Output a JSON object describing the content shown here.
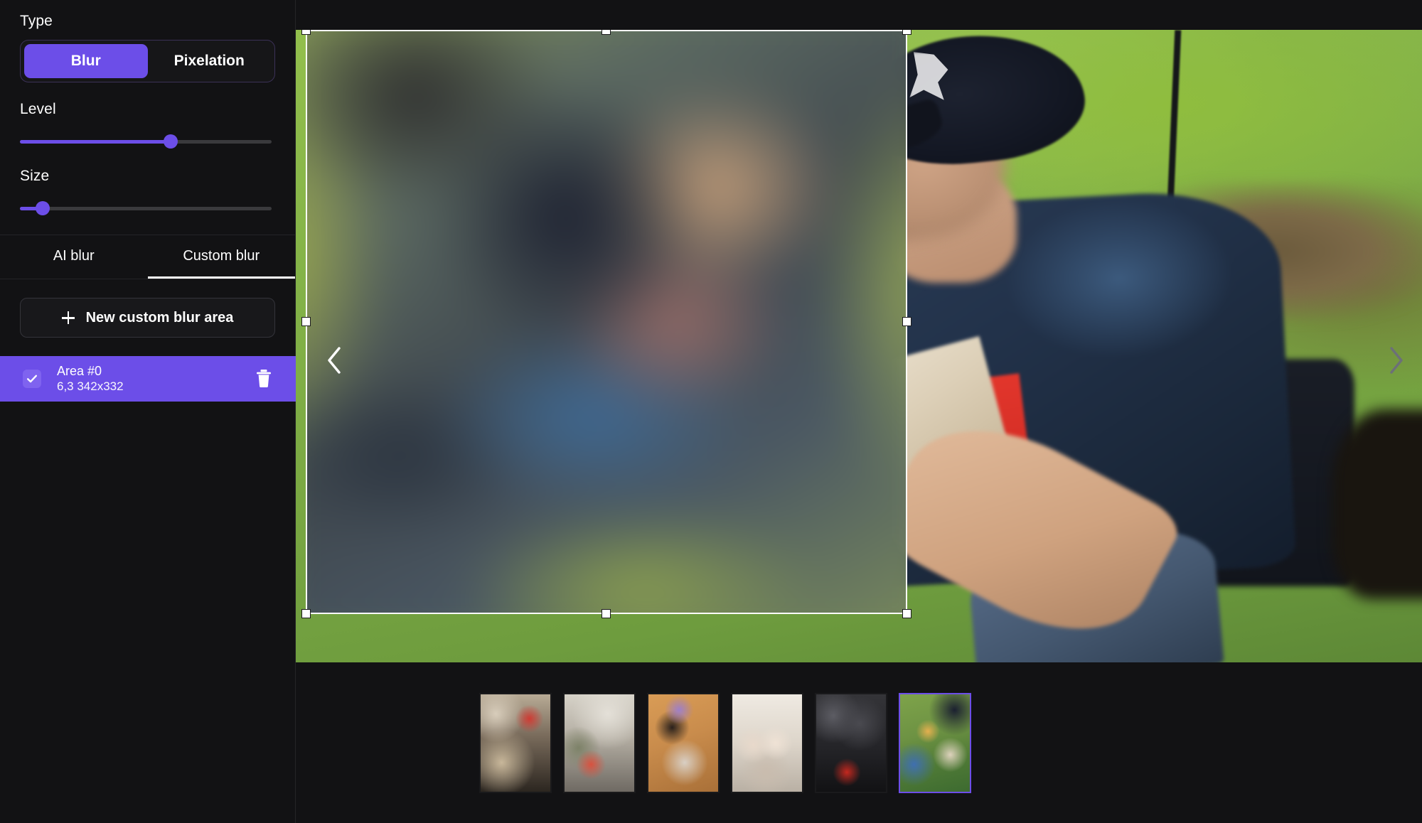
{
  "sidebar": {
    "type_section": {
      "label": "Type",
      "options": [
        "Blur",
        "Pixelation"
      ],
      "selected": "Blur"
    },
    "level_section": {
      "label": "Level",
      "value_percent": 60
    },
    "size_section": {
      "label": "Size",
      "value_percent": 9
    },
    "tabs": {
      "items": [
        "AI blur",
        "Custom blur"
      ],
      "selected": "Custom blur"
    },
    "new_area_button": {
      "label": "New custom blur area",
      "icon": "plus-icon"
    },
    "areas": [
      {
        "title": "Area #0",
        "geometry": "6,3 342x332",
        "checked": true,
        "selected": true,
        "delete_icon": "trash-icon"
      }
    ]
  },
  "canvas": {
    "prev_button_icon": "chevron-left-icon",
    "next_button_icon": "chevron-right-icon",
    "selection": {
      "handles": [
        "top-left",
        "top-center",
        "top-right",
        "middle-left",
        "middle-right",
        "bottom-left",
        "bottom-center",
        "bottom-right"
      ]
    }
  },
  "filmstrip": {
    "thumbnails": [
      {
        "id": "thumb-1",
        "selected": false
      },
      {
        "id": "thumb-2",
        "selected": false
      },
      {
        "id": "thumb-3",
        "selected": false
      },
      {
        "id": "thumb-4",
        "selected": false
      },
      {
        "id": "thumb-5",
        "selected": false
      },
      {
        "id": "thumb-6",
        "selected": true
      }
    ]
  },
  "colors": {
    "accent": "#6c4ee8",
    "background": "#121214",
    "panel_border": "#242427",
    "text_primary": "#ffffff",
    "slider_track": "#3a3a3d",
    "selection_outline": "#ffffff"
  }
}
